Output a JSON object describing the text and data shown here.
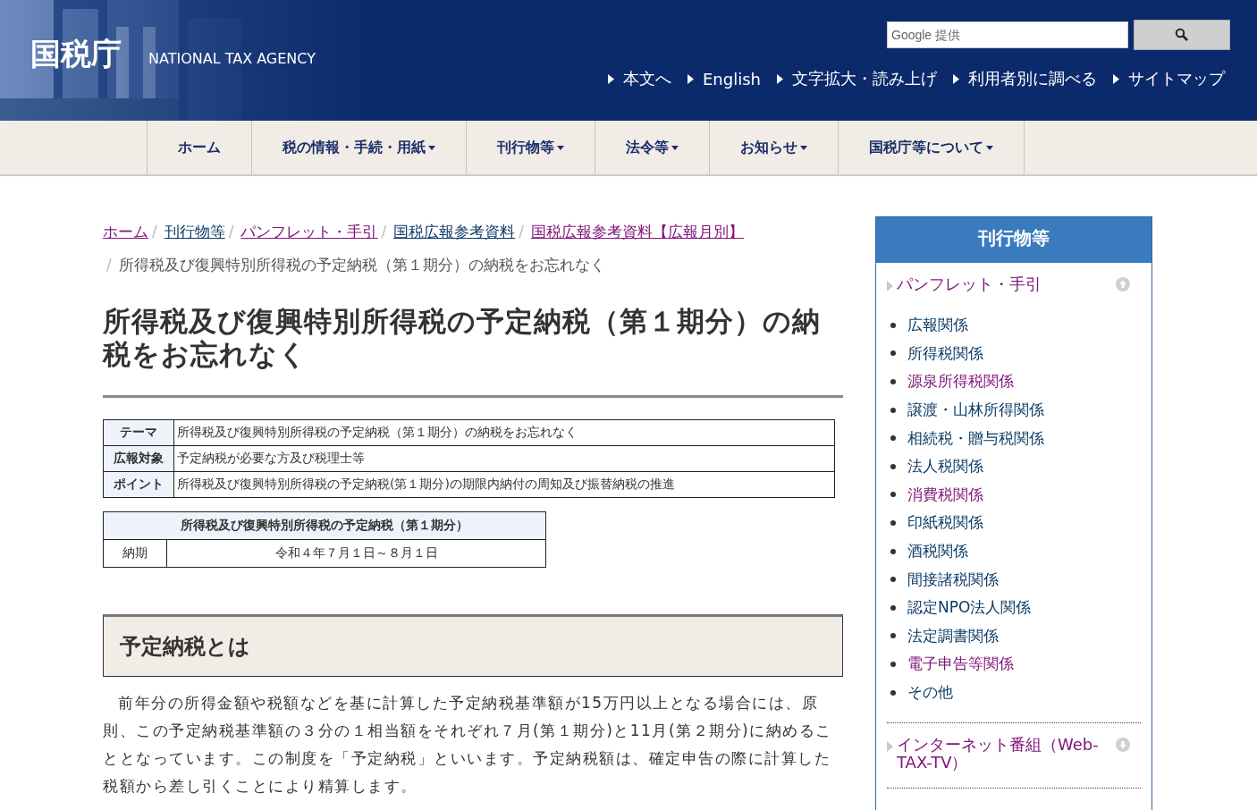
{
  "header": {
    "logo": "国税庁",
    "logo_sub": "NATIONAL TAX AGENCY",
    "search": {
      "placeholder": "Google 提供"
    },
    "links": [
      "本文へ",
      "English",
      "文字拡大・読み上げ",
      "利用者別に調べる",
      "サイトマップ"
    ]
  },
  "nav": [
    {
      "label": "ホーム",
      "has_menu": false
    },
    {
      "label": "税の情報・手続・用紙",
      "has_menu": true
    },
    {
      "label": "刊行物等",
      "has_menu": true
    },
    {
      "label": "法令等",
      "has_menu": true
    },
    {
      "label": "お知らせ",
      "has_menu": true
    },
    {
      "label": "国税庁等について",
      "has_menu": true
    }
  ],
  "breadcrumb": [
    {
      "label": "ホーム",
      "link": true,
      "visited": true
    },
    {
      "separator": "/",
      "label": "刊行物等",
      "link": true,
      "visited": false
    },
    {
      "separator": "/",
      "label": "パンフレット・手引",
      "link": true,
      "visited": true
    },
    {
      "separator": "/",
      "label": "国税広報参考資料",
      "link": true,
      "visited": false
    },
    {
      "separator": "/",
      "label": "国税広報参考資料【広報月別】",
      "link": true,
      "visited": true
    },
    {
      "separator": "/",
      "label": "所得税及び復興特別所得税の予定納税（第１期分）の納税をお忘れなく",
      "link": false
    }
  ],
  "title": "所得税及び復興特別所得税の予定納税（第１期分）の納税をお忘れなく",
  "info_table": [
    {
      "label": "テーマ",
      "value": "所得税及び復興特別所得税の予定納税（第１期分）の納税をお忘れなく"
    },
    {
      "label": "広報対象",
      "value": "予定納税が必要な方及び税理士等"
    },
    {
      "label": "ポイント",
      "value": "所得税及び復興特別所得税の予定納税(第１期分)の期限内納付の周知及び振替納税の推進"
    }
  ],
  "schedule_table": {
    "heading": "所得税及び復興特別所得税の予定納税（第１期分）",
    "rows": [
      {
        "label": "納期",
        "value": "令和４年７月１日～８月１日"
      }
    ]
  },
  "section": {
    "heading": "予定納税とは",
    "paragraph": "前年分の所得金額や税額などを基に計算した予定納税基準額が15万円以上となる場合には、原則、この予定納税基準額の３分の１相当額をそれぞれ７月(第１期分)と11月(第２期分)に納めることとなっています。この制度を「予定納税」といいます。予定納税額は、確定申告の際に計算した税額から差し引くことにより精算します。"
  },
  "sidebar": {
    "heading": "刊行物等",
    "sections": [
      {
        "label": "パンフレット・手引",
        "visited": true,
        "expanded": true,
        "items": [
          {
            "label": "広報関係",
            "visited": false
          },
          {
            "label": "所得税関係",
            "visited": false
          },
          {
            "label": "源泉所得税関係",
            "visited": true
          },
          {
            "label": "譲渡・山林所得関係",
            "visited": false
          },
          {
            "label": "相続税・贈与税関係",
            "visited": false
          },
          {
            "label": "法人税関係",
            "visited": false
          },
          {
            "label": "消費税関係",
            "visited": true
          },
          {
            "label": "印紙税関係",
            "visited": false
          },
          {
            "label": "酒税関係",
            "visited": false
          },
          {
            "label": "間接諸税関係",
            "visited": false
          },
          {
            "label": "認定NPO法人関係",
            "visited": false
          },
          {
            "label": "法定調書関係",
            "visited": false
          },
          {
            "label": "電子申告等関係",
            "visited": true
          },
          {
            "label": "その他",
            "visited": false
          }
        ]
      },
      {
        "label": "インターネット番組（Web-TAX-TV）",
        "visited": true,
        "expanded": false
      }
    ]
  }
}
